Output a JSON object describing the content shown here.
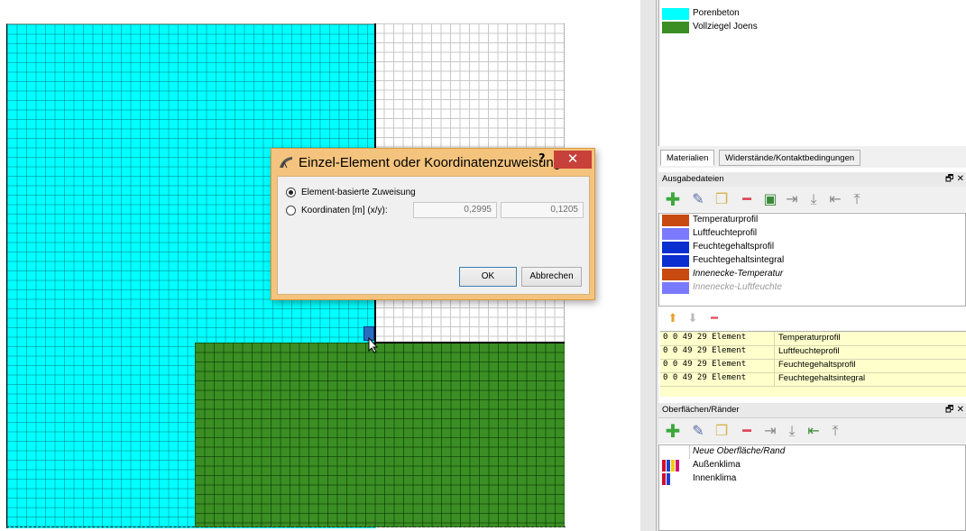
{
  "dialog": {
    "title": "Einzel-Element oder Koordinatenzuweisung ...",
    "help": "?",
    "close": "✕",
    "option_element": "Element-basierte Zuweisung",
    "option_coords": "Koordinaten [m] (x/y):",
    "x_value": "0,2995",
    "y_value": "0,1205",
    "ok": "OK",
    "cancel": "Abbrechen"
  },
  "materials": {
    "items": [
      {
        "label": "Porenbeton",
        "color": "#00ffff"
      },
      {
        "label": "Vollziegel Joens",
        "color": "#3b8e23"
      }
    ],
    "tabs": [
      "Materialien",
      "Widerstände/Kontaktbedingungen"
    ]
  },
  "outputs": {
    "title": "Ausgabedateien",
    "items": [
      {
        "label": "Temperaturprofil",
        "color": "#c84a10"
      },
      {
        "label": "Luftfeuchteprofil",
        "color": "#7a7aff"
      },
      {
        "label": "Feuchtegehaltsprofil",
        "color": "#0a2ed0"
      },
      {
        "label": "Feuchtegehaltsintegral",
        "color": "#0a2ed0"
      },
      {
        "label": "Innenecke-Temperatur",
        "color": "#c84a10"
      },
      {
        "label": "Innenecke-Luftfeuchte",
        "color": "#7a7aff"
      }
    ],
    "file_rows": [
      {
        "spec": "0 0 49 29 Element",
        "name": "Temperaturprofil"
      },
      {
        "spec": "0 0 49 29 Element",
        "name": "Luftfeuchteprofil"
      },
      {
        "spec": "0 0 49 29 Element",
        "name": "Feuchtegehaltsprofil"
      },
      {
        "spec": "0 0 49 29 Element",
        "name": "Feuchtegehaltsintegral"
      }
    ]
  },
  "surfaces": {
    "title": "Oberflächen/Ränder",
    "items": [
      {
        "label": "Neue Oberfläche/Rand"
      },
      {
        "label": "Außenklima"
      },
      {
        "label": "Innenklima"
      }
    ]
  },
  "panel_controls": {
    "float_close": "🗗 ✕"
  }
}
